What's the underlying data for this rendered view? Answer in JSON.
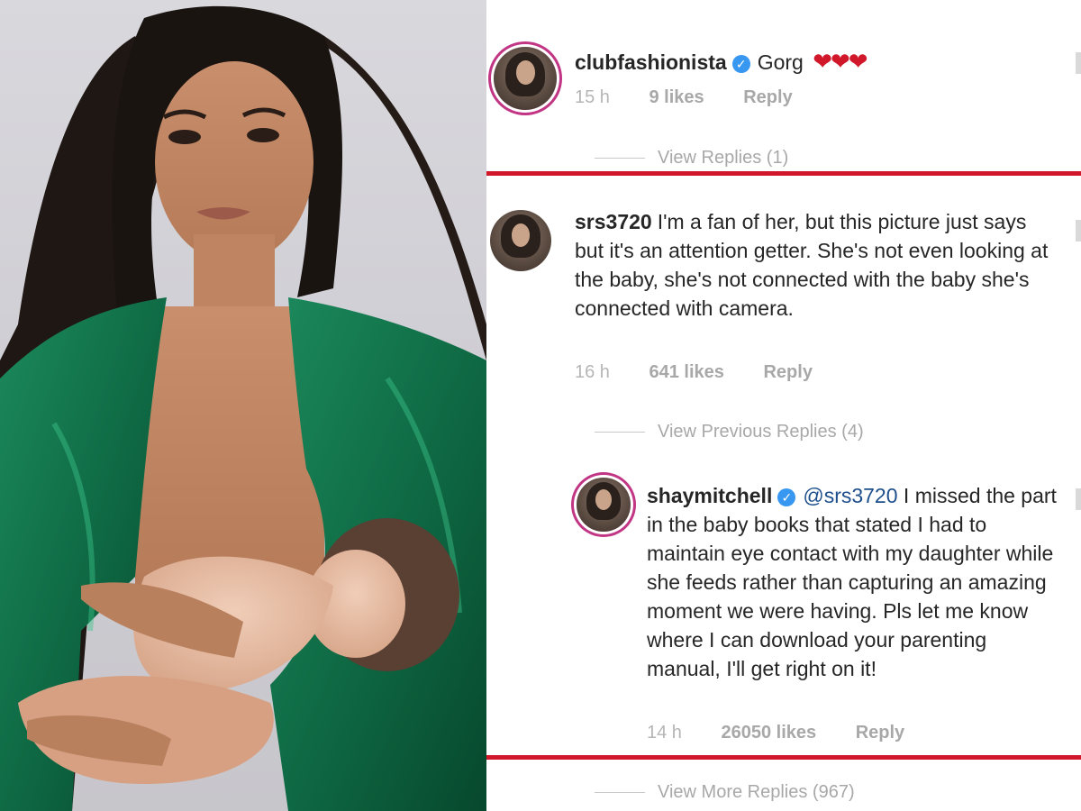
{
  "comments": [
    {
      "username": "clubfashionista",
      "verified": true,
      "text": "Gorg",
      "emoji": "❤❤❤",
      "time": "15 h",
      "likes": "9 likes",
      "reply_label": "Reply",
      "view_replies": "View Replies (1)"
    },
    {
      "username": "srs3720",
      "verified": false,
      "text": "I'm a fan of her, but this picture just says but it's an attention getter. She's not even looking at the baby, she's not connected with the baby she's connected with camera.",
      "time": "16 h",
      "likes": "641 likes",
      "reply_label": "Reply",
      "view_replies": "View Previous Replies (4)"
    },
    {
      "username": "shaymitchell",
      "verified": true,
      "mention": "@srs3720",
      "text": "I missed the part in the baby books that stated I had to maintain eye contact with my daughter while she feeds rather than capturing an amazing moment we were having. Pls let me know where I can download your parenting manual, I'll get right on it!",
      "time": "14 h",
      "likes": "26050 likes",
      "reply_label": "Reply",
      "view_replies": "View More Replies (967)"
    }
  ],
  "colors": {
    "highlight_line": "#d0182a",
    "verified_badge": "#3897f0",
    "mention": "#1d4f8c",
    "jacket": "#0f6b45"
  },
  "icons": {
    "verified": "verified-badge-icon",
    "heart": "heart-icon"
  }
}
